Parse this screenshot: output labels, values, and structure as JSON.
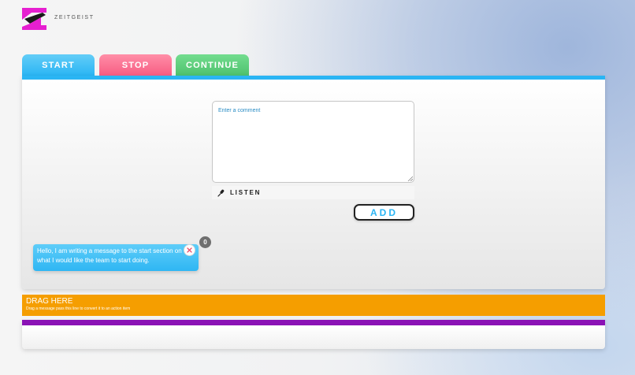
{
  "brand": {
    "name": "ZEITGEIST",
    "logo_icon": "zeitgeist-logo-icon",
    "logo_colors": [
      "#e61fd0",
      "#1a1a1a"
    ]
  },
  "tabs": [
    {
      "label": "START",
      "color": "#2ab5f4",
      "active": true
    },
    {
      "label": "STOP",
      "color": "#f75d83"
    },
    {
      "label": "CONTINUE",
      "color": "#4ec16e"
    }
  ],
  "comment": {
    "placeholder": "Enter a comment",
    "value": ""
  },
  "listen": {
    "label": "LISTEN",
    "icon": "microphone-icon"
  },
  "add_button": {
    "label": "ADD"
  },
  "note": {
    "text": "Hello, I am writing a message to the start section on what I would like the team to start doing.",
    "count": "0",
    "close_icon": "close-icon"
  },
  "drag": {
    "title": "DRAG HERE",
    "subtitle": "Drag a message pass this line to convert it to an action item",
    "color": "#f59e00"
  },
  "action_items": {
    "color": "#8a12b5"
  }
}
